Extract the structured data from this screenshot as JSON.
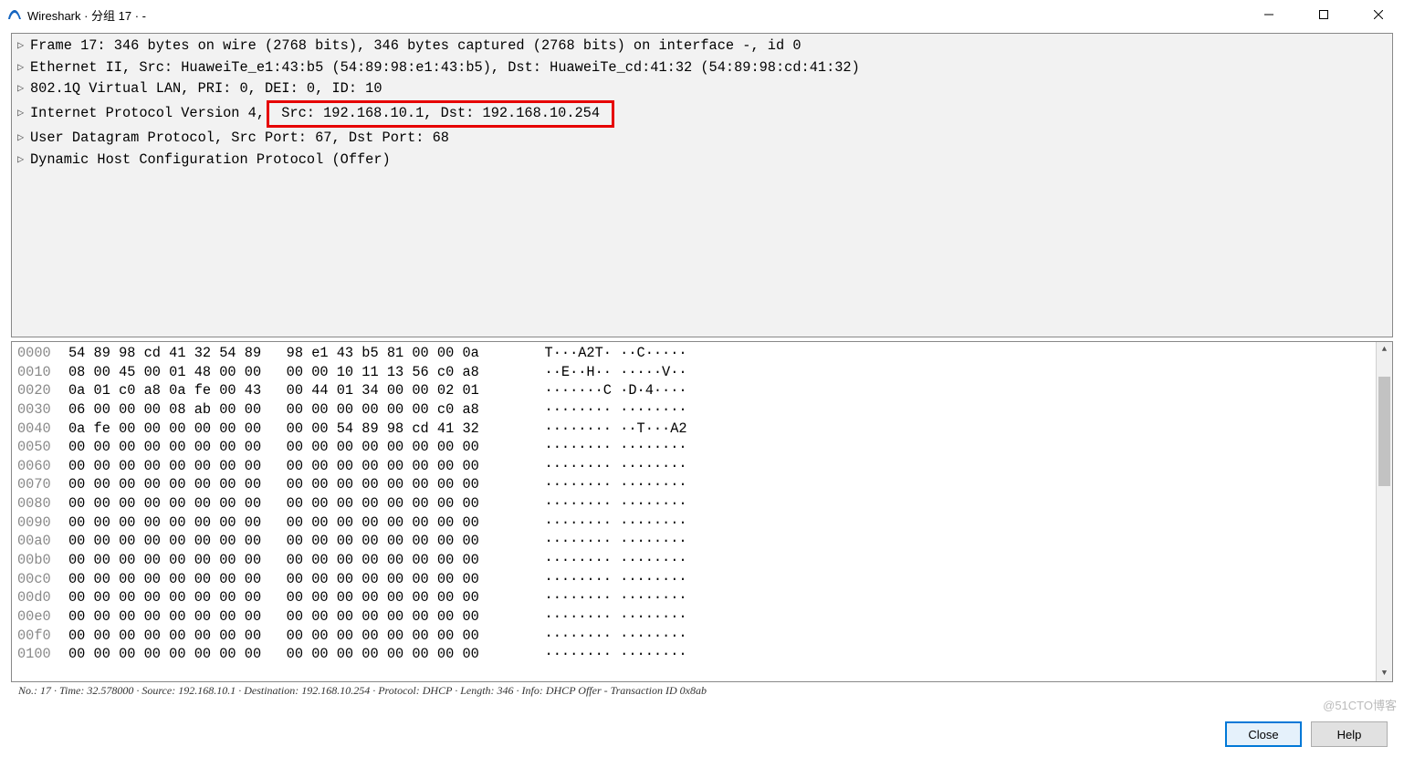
{
  "window": {
    "title": "Wireshark · 分组 17 · -"
  },
  "details": {
    "rows": [
      "Frame 17: 346 bytes on wire (2768 bits), 346 bytes captured (2768 bits) on interface -, id 0",
      "Ethernet II, Src: HuaweiTe_e1:43:b5 (54:89:98:e1:43:b5), Dst: HuaweiTe_cd:41:32 (54:89:98:cd:41:32)",
      "802.1Q Virtual LAN, PRI: 0, DEI: 0, ID: 10",
      "Internet Protocol Version 4,",
      "User Datagram Protocol, Src Port: 67, Dst Port: 68",
      "Dynamic Host Configuration Protocol (Offer)"
    ],
    "highlight": " Src: 192.168.10.1, Dst: 192.168.10.254 "
  },
  "hex": {
    "rows": [
      {
        "off": "0000",
        "hex": "54 89 98 cd 41 32 54 89   98 e1 43 b5 81 00 00 0a",
        "asc": "T···A2T· ··C·····"
      },
      {
        "off": "0010",
        "hex": "08 00 45 00 01 48 00 00   00 00 10 11 13 56 c0 a8",
        "asc": "··E··H·· ·····V··"
      },
      {
        "off": "0020",
        "hex": "0a 01 c0 a8 0a fe 00 43   00 44 01 34 00 00 02 01",
        "asc": "·······C ·D·4····"
      },
      {
        "off": "0030",
        "hex": "06 00 00 00 08 ab 00 00   00 00 00 00 00 00 c0 a8",
        "asc": "········ ········"
      },
      {
        "off": "0040",
        "hex": "0a fe 00 00 00 00 00 00   00 00 54 89 98 cd 41 32",
        "asc": "········ ··T···A2"
      },
      {
        "off": "0050",
        "hex": "00 00 00 00 00 00 00 00   00 00 00 00 00 00 00 00",
        "asc": "········ ········"
      },
      {
        "off": "0060",
        "hex": "00 00 00 00 00 00 00 00   00 00 00 00 00 00 00 00",
        "asc": "········ ········"
      },
      {
        "off": "0070",
        "hex": "00 00 00 00 00 00 00 00   00 00 00 00 00 00 00 00",
        "asc": "········ ········"
      },
      {
        "off": "0080",
        "hex": "00 00 00 00 00 00 00 00   00 00 00 00 00 00 00 00",
        "asc": "········ ········"
      },
      {
        "off": "0090",
        "hex": "00 00 00 00 00 00 00 00   00 00 00 00 00 00 00 00",
        "asc": "········ ········"
      },
      {
        "off": "00a0",
        "hex": "00 00 00 00 00 00 00 00   00 00 00 00 00 00 00 00",
        "asc": "········ ········"
      },
      {
        "off": "00b0",
        "hex": "00 00 00 00 00 00 00 00   00 00 00 00 00 00 00 00",
        "asc": "········ ········"
      },
      {
        "off": "00c0",
        "hex": "00 00 00 00 00 00 00 00   00 00 00 00 00 00 00 00",
        "asc": "········ ········"
      },
      {
        "off": "00d0",
        "hex": "00 00 00 00 00 00 00 00   00 00 00 00 00 00 00 00",
        "asc": "········ ········"
      },
      {
        "off": "00e0",
        "hex": "00 00 00 00 00 00 00 00   00 00 00 00 00 00 00 00",
        "asc": "········ ········"
      },
      {
        "off": "00f0",
        "hex": "00 00 00 00 00 00 00 00   00 00 00 00 00 00 00 00",
        "asc": "········ ········"
      },
      {
        "off": "0100",
        "hex": "00 00 00 00 00 00 00 00   00 00 00 00 00 00 00 00",
        "asc": "········ ········"
      }
    ]
  },
  "statusbar": {
    "text": "No.: 17  ·  Time: 32.578000  ·  Source: 192.168.10.1  ·  Destination: 192.168.10.254  ·  Protocol: DHCP  ·  Length: 346  ·  Info: DHCP Offer - Transaction ID 0x8ab"
  },
  "buttons": {
    "close": "Close",
    "help": "Help"
  },
  "watermark": "@51CTO博客"
}
